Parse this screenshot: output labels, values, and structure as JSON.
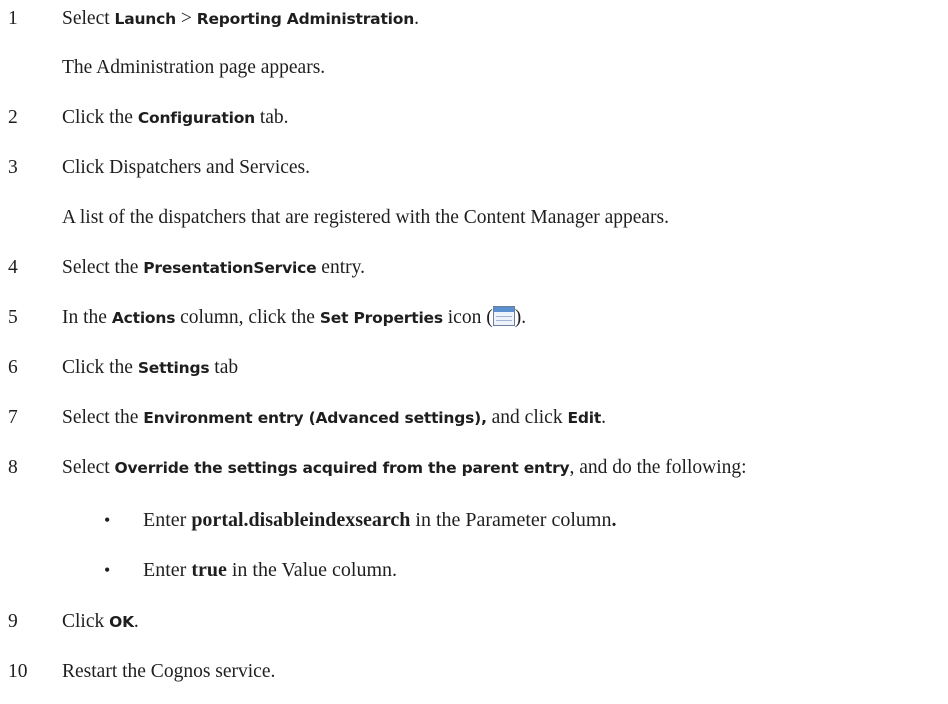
{
  "steps": [
    {
      "num": "1",
      "parts": [
        "Select ",
        "Launch",
        " > ",
        "Reporting Administration",
        "."
      ]
    },
    {
      "sub": "The Administration page appears."
    },
    {
      "num": "2",
      "parts": [
        "Click the ",
        "Configuration",
        " tab."
      ]
    },
    {
      "num": "3",
      "text": "Click Dispatchers and Services."
    },
    {
      "sub": "A list of the dispatchers that are registered with the Content Manager appears."
    },
    {
      "num": "4",
      "parts": [
        "Select the ",
        "PresentationService",
        " entry."
      ]
    },
    {
      "num": "5",
      "parts": [
        "In the ",
        "Actions",
        " column, click the ",
        "Set Properties",
        " icon (",
        ")."
      ]
    },
    {
      "num": "6",
      "parts": [
        "Click the ",
        "Settings",
        " tab"
      ]
    },
    {
      "num": "7",
      "parts": [
        "Select the ",
        "Environment entry (Advanced settings),",
        " and click ",
        "Edit",
        "."
      ]
    },
    {
      "num": "8",
      "parts": [
        "Select ",
        "Override the settings acquired from the parent entry",
        ", and do the following:"
      ]
    },
    {
      "bullet": [
        "Enter ",
        "portal.disableindexsearch",
        " in the Parameter column",
        "."
      ]
    },
    {
      "bullet": [
        "Enter ",
        "true",
        " in the Value column."
      ]
    },
    {
      "num": "9",
      "parts": [
        "Click ",
        "OK",
        "."
      ]
    },
    {
      "num": "10",
      "text": "Restart the Cognos service."
    }
  ],
  "icons": {
    "set_properties": "set-properties-icon"
  }
}
